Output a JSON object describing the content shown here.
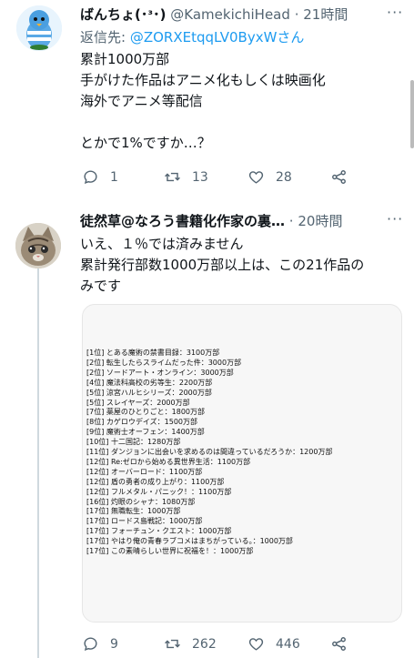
{
  "tweet1": {
    "display_name": "ばんちょ(･ᶟ･)",
    "handle": "@KamekichiHead",
    "time": "21時間",
    "more": "···",
    "reply_prefix": "返信先: ",
    "reply_handle": "@ZORXEtqqLV0ByxW",
    "reply_suffix": "さん",
    "lines": [
      "累計1000万部",
      "手がけた作品はアニメ化もしくは映画化",
      "海外でアニメ等配信",
      "",
      "とかで1%ですか…？"
    ],
    "stats": {
      "replies": "1",
      "retweets": "13",
      "likes": "28"
    }
  },
  "tweet2": {
    "display_name": "徒然草@なろう書籍化作家の裏…",
    "time": "20時間",
    "more": "···",
    "lines": [
      "いえ、１％では済みません",
      "累計発行部数1000万部以上は、この21作品の",
      "みです"
    ],
    "stats": {
      "replies": "9",
      "retweets": "262",
      "likes": "446"
    }
  },
  "ranking": [
    "[1位] とある魔術の禁書目録：3100万部",
    "[2位] 転生したらスライムだった件：3000万部",
    "[2位] ソードアート・オンライン：3000万部",
    "[4位] 魔法科高校の劣等生：2200万部",
    "[5位] 涼宮ハルヒシリーズ：2000万部",
    "[5位] スレイヤーズ：2000万部",
    "[7位] 薬屋のひとりごと：1800万部",
    "[8位] カゲロウデイズ：1500万部",
    "[9位] 魔術士オーフェン：1400万部",
    "[10位] 十二国記：1280万部",
    "[11位] ダンジョンに出会いを求めるのは間違っているだろうか：1200万部",
    "[12位] Re:ゼロから始める異世界生活：1100万部",
    "[12位] オーバーロード：1100万部",
    "[12位] 盾の勇者の成り上がり：1100万部",
    "[12位] フルメタル・パニック！：1100万部",
    "[16位] 灼眼のシャナ：1080万部",
    "[17位] 無職転生：1000万部",
    "[17位] ロードス島戦記：1000万部",
    "[17位] フォーチュン・クエスト：1000万部",
    "[17位] やはり俺の青春ラブコメはまちがっている。：1000万部",
    "[17位] この素晴らしい世界に祝福を！：1000万部"
  ],
  "colors": {
    "accent": "#1d9bf0",
    "muted": "#536471",
    "text": "#0f1419"
  }
}
